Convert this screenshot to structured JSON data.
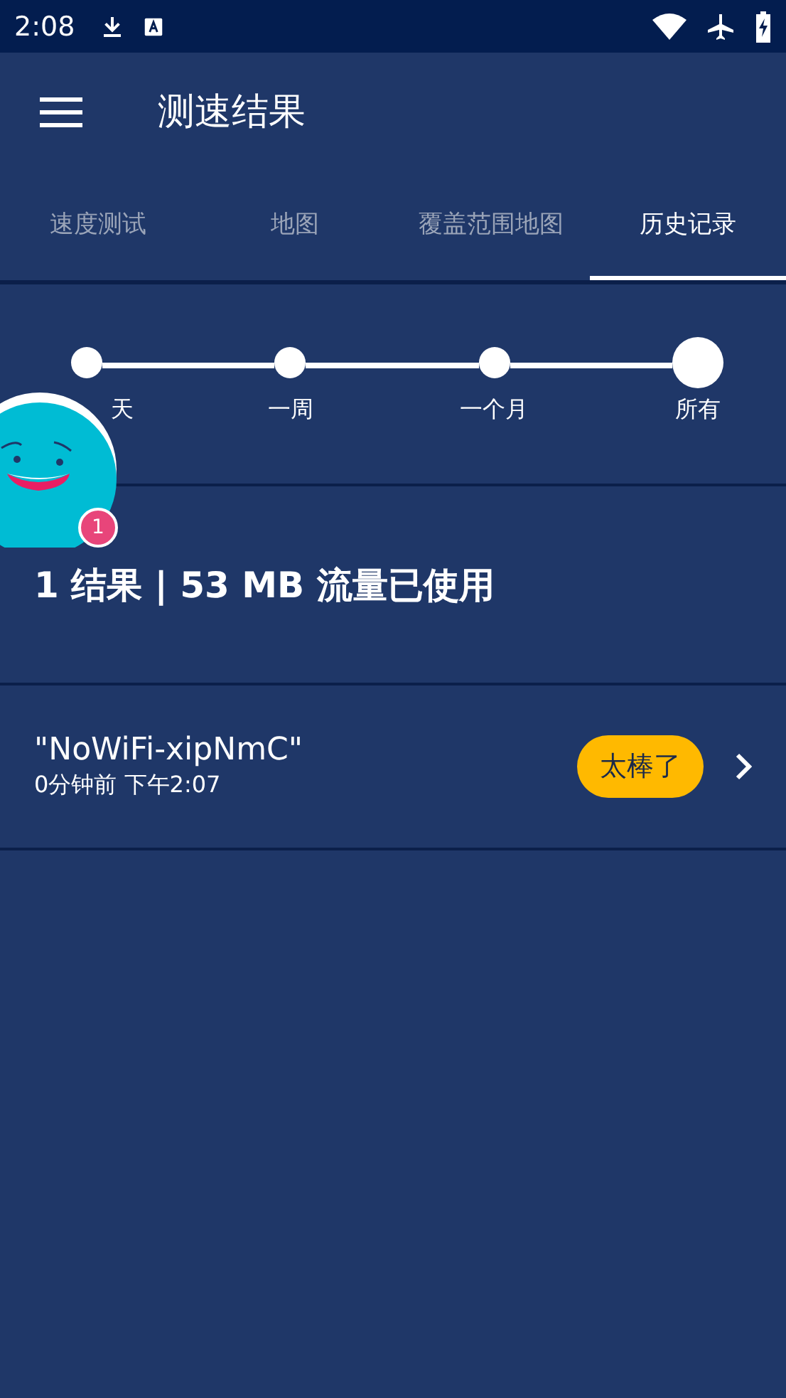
{
  "status_bar": {
    "time": "2:08"
  },
  "app_bar": {
    "title": "测速结果"
  },
  "tabs": [
    {
      "label": "速度测试",
      "selected": false
    },
    {
      "label": "地图",
      "selected": false
    },
    {
      "label": "覆盖范围地图",
      "selected": false
    },
    {
      "label": "历史记录",
      "selected": true
    }
  ],
  "range_slider": {
    "stops": [
      {
        "label": "天",
        "selected": false
      },
      {
        "label": "一周",
        "selected": false
      },
      {
        "label": "一个月",
        "selected": false
      },
      {
        "label": "所有",
        "selected": true
      }
    ]
  },
  "mascot": {
    "badge": "1"
  },
  "summary": "1 结果 | 53 MB 流量已使用",
  "results": [
    {
      "name": "\"NoWiFi-xipNmC\"",
      "time": "0分钟前 下午2:07",
      "rating": "太棒了"
    }
  ]
}
